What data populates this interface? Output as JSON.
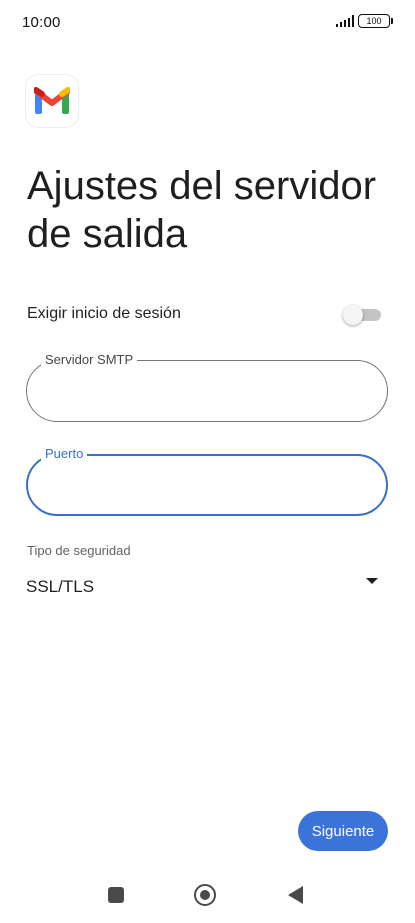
{
  "status_bar": {
    "time": "10:00",
    "battery": "100",
    "signal_icon": "signal-bars-icon",
    "battery_icon": "battery-icon"
  },
  "app": {
    "logo_icon": "gmail-logo-icon",
    "colors": {
      "red": "#ea4335",
      "blue": "#4285f4",
      "green": "#34a853",
      "yellow": "#fbbc04"
    }
  },
  "page": {
    "title": "Ajustes del servidor de salida"
  },
  "login_toggle": {
    "label": "Exigir inicio de sesión",
    "enabled": false
  },
  "smtp_field": {
    "label": "Servidor SMTP",
    "value": ""
  },
  "port_field": {
    "label": "Puerto",
    "value": "",
    "focused": true
  },
  "security": {
    "label": "Tipo de seguridad",
    "value": "SSL/TLS",
    "icon": "dropdown-arrow-icon"
  },
  "actions": {
    "next_label": "Siguiente"
  },
  "nav": {
    "recents_icon": "square-recents-icon",
    "home_icon": "circle-home-icon",
    "back_icon": "triangle-back-icon"
  },
  "theme": {
    "accent": "#3c73d8",
    "field_focus": "#3a6fce",
    "text": "#1f1f1f"
  }
}
